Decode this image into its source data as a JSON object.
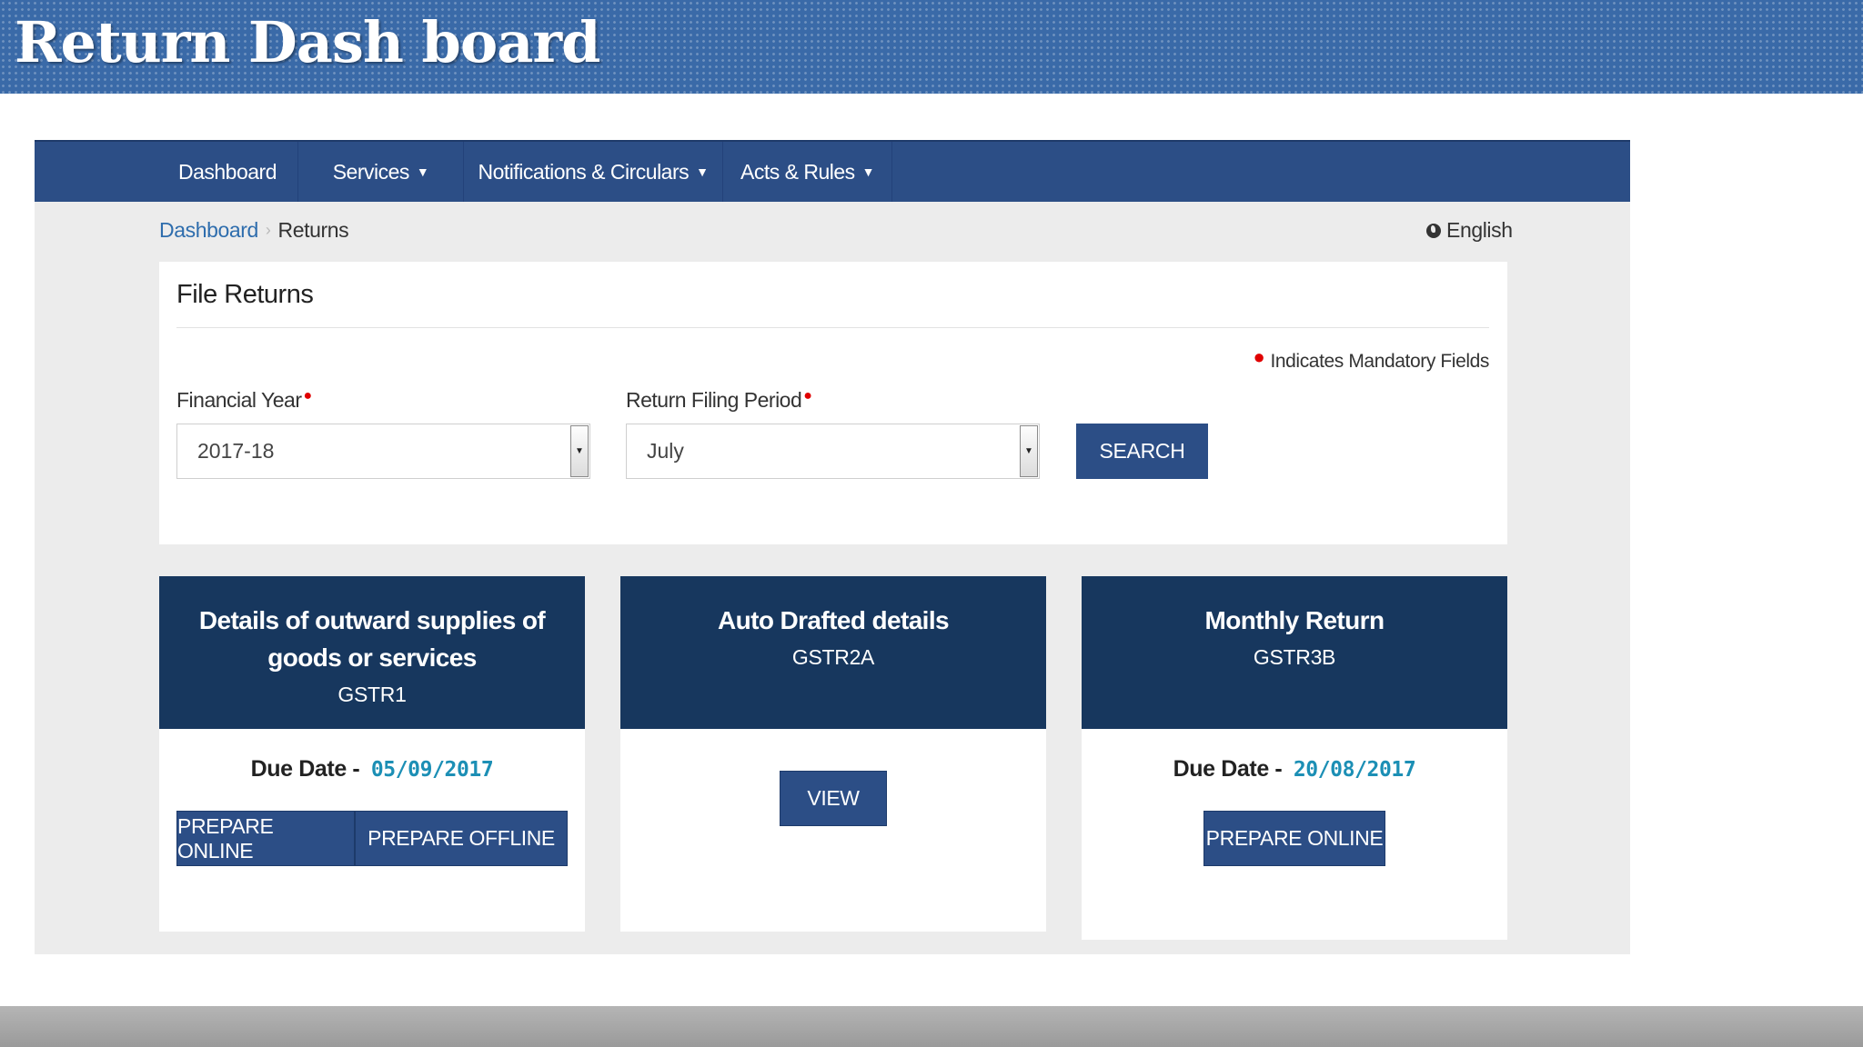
{
  "banner": {
    "title": "Return Dash board"
  },
  "nav": {
    "items": [
      {
        "label": "Dashboard"
      },
      {
        "label": "Services"
      },
      {
        "label": "Notifications & Circulars"
      },
      {
        "label": "Acts & Rules"
      }
    ]
  },
  "breadcrumb": {
    "home": "Dashboard",
    "current": "Returns"
  },
  "language": "English",
  "file_returns": {
    "title": "File Returns",
    "mandatory_note": "Indicates Mandatory Fields",
    "financial_year": {
      "label": "Financial Year",
      "value": "2017-18"
    },
    "filing_period": {
      "label": "Return Filing Period",
      "value": "July"
    },
    "search_label": "SEARCH"
  },
  "cards": [
    {
      "title": "Details of outward supplies of goods or services",
      "code": "GSTR1",
      "due_label": "Due Date -",
      "due_date": "05/09/2017",
      "buttons": [
        "PREPARE ONLINE",
        "PREPARE OFFLINE"
      ]
    },
    {
      "title": "Auto Drafted details",
      "code": "GSTR2A",
      "buttons": [
        "VIEW"
      ]
    },
    {
      "title": "Monthly Return",
      "code": "GSTR3B",
      "due_label": "Due Date -",
      "due_date": "20/08/2017",
      "buttons": [
        "PREPARE ONLINE"
      ]
    }
  ],
  "colors": {
    "navbar": "#2c4e86",
    "card_header": "#17375e",
    "due_date": "#1c8fb5",
    "required": "#e00000"
  }
}
